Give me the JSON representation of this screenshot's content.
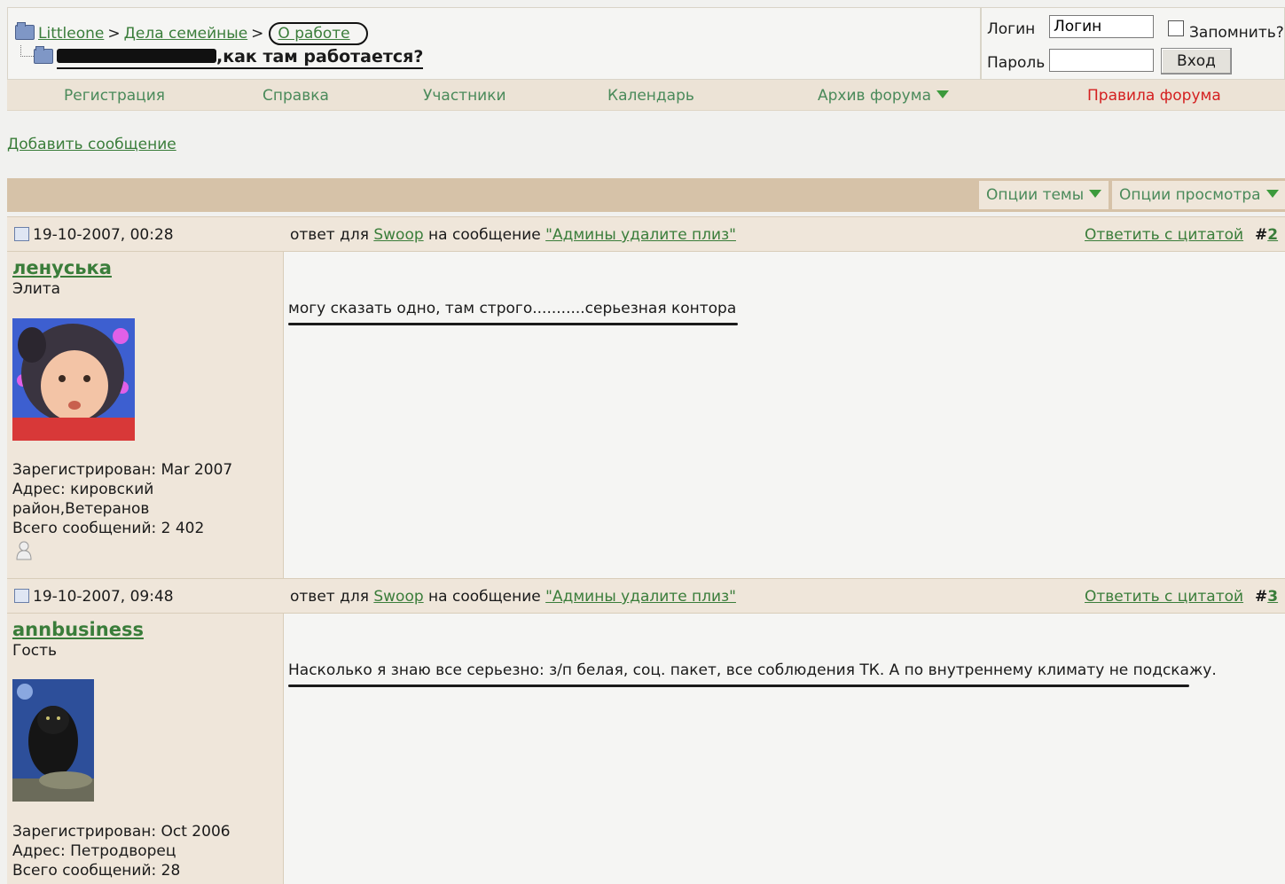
{
  "breadcrumb": {
    "items": [
      "Littleone",
      "Дела семейные",
      "О работе"
    ],
    "separator": ">",
    "thread_title": ",как там работается?"
  },
  "login": {
    "login_label": "Логин",
    "login_value": "Логин",
    "remember_label": "Запомнить?",
    "password_label": "Пароль",
    "submit_label": "Вход"
  },
  "nav": {
    "items": [
      "Регистрация",
      "Справка",
      "Участники",
      "Календарь",
      "Архив форума",
      "Правила форума"
    ]
  },
  "actions": {
    "add_message": "Добавить сообщение"
  },
  "tools": {
    "thread_options": "Опции темы",
    "view_options": "Опции просмотра"
  },
  "posts": [
    {
      "date": "19-10-2007, 00:28",
      "reply_prefix": "ответ для",
      "reply_user": "Swoop",
      "reply_middle": "на сообщение",
      "reply_topic": "\"Админы удалите плиз\"",
      "quote_label": "Ответить с цитатой",
      "num_prefix": "#",
      "num": "2",
      "username": "ленуська",
      "usertitle": "Элита",
      "registered": "Зарегистрирован: Mar 2007",
      "address_1": "Адрес: кировский",
      "address_2": "район,Ветеранов",
      "posts_count": "Всего сообщений: 2 402",
      "message": "могу сказать одно, там строго...........серьезная контора"
    },
    {
      "date": "19-10-2007, 09:48",
      "reply_prefix": "ответ для",
      "reply_user": "Swoop",
      "reply_middle": "на сообщение",
      "reply_topic": "\"Админы удалите плиз\"",
      "quote_label": "Ответить с цитатой",
      "num_prefix": "#",
      "num": "3",
      "username": "annbusiness",
      "usertitle": "Гость",
      "registered": "Зарегистрирован: Oct 2006",
      "address_1": "Адрес: Петродворец",
      "posts_count": "Всего сообщений: 28",
      "message": "Насколько я знаю все серьезно: з/п белая, соц. пакет, все соблюдения ТК. А по внутреннему климату не подскажу."
    }
  ],
  "colors": {
    "link": "#3a7d3a",
    "nav_text": "#4a8a5a",
    "rules_red": "#d42020",
    "bar_tan": "#d6c2a8",
    "row_beige": "#efe6da"
  }
}
